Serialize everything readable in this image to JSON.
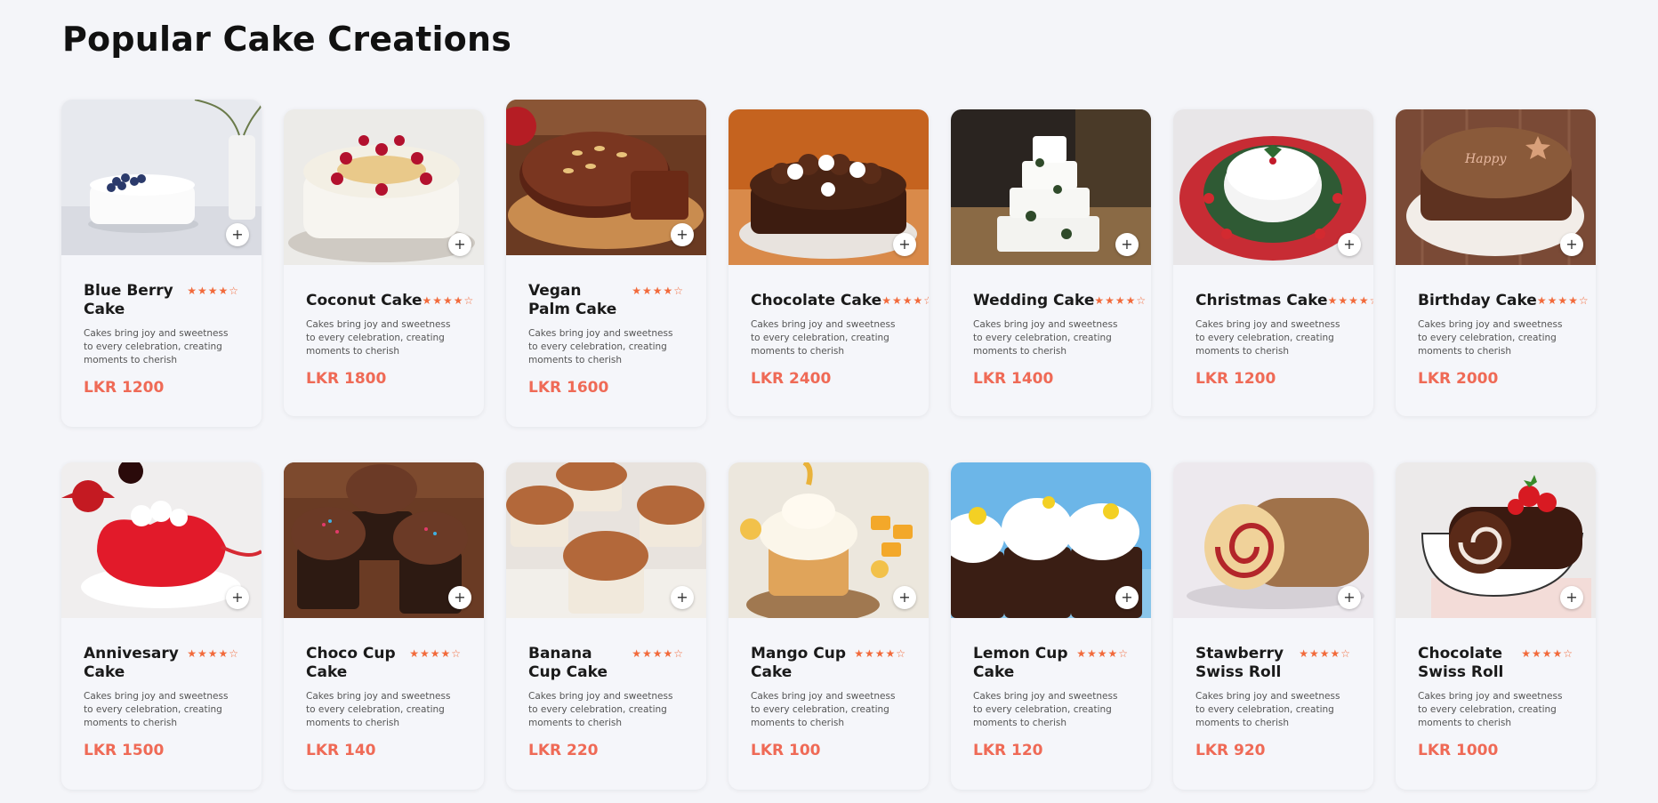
{
  "page": {
    "title": "Popular Cake Creations"
  },
  "colors": {
    "accent": "#ef6a56",
    "star": "#f26a3b",
    "background": "#f4f5f9",
    "card": "#f5f6fa"
  },
  "icons": {
    "add": "plus-icon",
    "rating": "star-icon"
  },
  "rating": {
    "stars": "★★★★☆",
    "value": 4,
    "max": 5
  },
  "add_label": "+",
  "description": "Cakes bring joy and sweetness to every celebration, creating moments to cherish",
  "products": [
    {
      "name": "Blue Berry Cake",
      "price": "LKR 1200"
    },
    {
      "name": "Coconut Cake",
      "price": "LKR 1800"
    },
    {
      "name": "Vegan Palm Cake",
      "price": "LKR 1600"
    },
    {
      "name": "Chocolate Cake",
      "price": "LKR 2400"
    },
    {
      "name": "Wedding Cake",
      "price": "LKR 1400"
    },
    {
      "name": "Christmas Cake",
      "price": "LKR 1200"
    },
    {
      "name": "Birthday Cake",
      "price": "LKR 2000"
    },
    {
      "name": "Annivesary Cake",
      "price": "LKR 1500"
    },
    {
      "name": "Choco Cup Cake",
      "price": "LKR 140"
    },
    {
      "name": "Banana Cup Cake",
      "price": "LKR 220"
    },
    {
      "name": "Mango Cup Cake",
      "price": "LKR 100"
    },
    {
      "name": "Lemon Cup Cake",
      "price": "LKR 120"
    },
    {
      "name": "Stawberry Swiss Roll",
      "price": "LKR 920"
    },
    {
      "name": "Chocolate Swiss Roll",
      "price": "LKR 1000"
    }
  ]
}
